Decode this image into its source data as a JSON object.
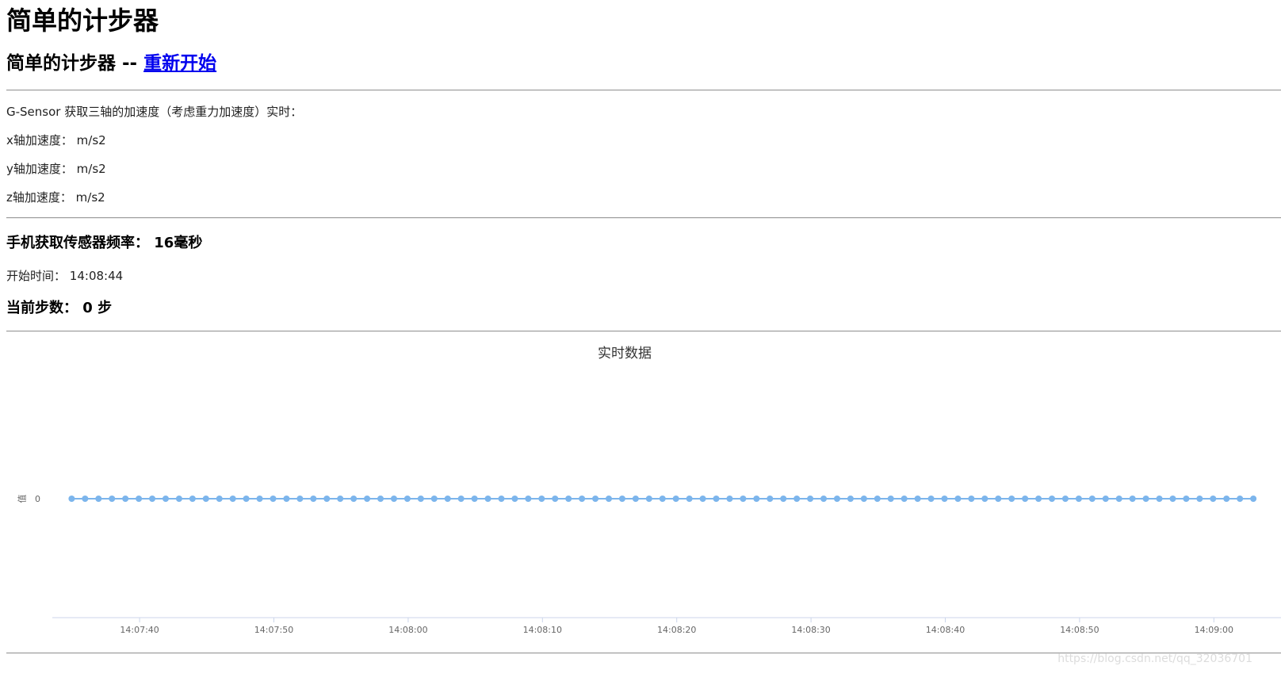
{
  "page": {
    "heading": "简单的计步器",
    "subheading_prefix": "简单的计步器 --",
    "restart_link": "重新开始"
  },
  "sensor": {
    "intro": "G-Sensor 获取三轴的加速度（考虑重力加速度）实时：",
    "x_label": "x轴加速度：",
    "x_unit": "m/s2",
    "y_label": "y轴加速度：",
    "y_unit": "m/s2",
    "z_label": "z轴加速度：",
    "z_unit": "m/s2"
  },
  "stats": {
    "freq_label": "手机获取传感器频率：",
    "freq_value": "16毫秒",
    "start_label": "开始时间：",
    "start_value": "14:08:44",
    "steps_label": "当前步数：",
    "steps_value": "0 步"
  },
  "chart_data": {
    "type": "line",
    "title": "实时数据",
    "ylabel": "值",
    "xlabel": "",
    "x_ticks": [
      "14:07:40",
      "14:07:50",
      "14:08:00",
      "14:08:10",
      "14:08:20",
      "14:08:30",
      "14:08:40",
      "14:08:50",
      "14:09:00"
    ],
    "y_ticks": [
      "0"
    ],
    "series_color": "#7cb5ec",
    "x_range": [
      "14:07:33.5",
      "14:09:05"
    ],
    "point_interval_seconds": 1,
    "point_count": 89,
    "values": [
      0,
      0,
      0,
      0,
      0,
      0,
      0,
      0,
      0,
      0,
      0,
      0,
      0,
      0,
      0,
      0,
      0,
      0,
      0,
      0,
      0,
      0,
      0,
      0,
      0,
      0,
      0,
      0,
      0,
      0,
      0,
      0,
      0,
      0,
      0,
      0,
      0,
      0,
      0,
      0,
      0,
      0,
      0,
      0,
      0,
      0,
      0,
      0,
      0,
      0,
      0,
      0,
      0,
      0,
      0,
      0,
      0,
      0,
      0,
      0,
      0,
      0,
      0,
      0,
      0,
      0,
      0,
      0,
      0,
      0,
      0,
      0,
      0,
      0,
      0,
      0,
      0,
      0,
      0,
      0,
      0,
      0,
      0,
      0,
      0,
      0,
      0,
      0,
      0
    ]
  },
  "watermark": "https://blog.csdn.net/qq_32036701"
}
